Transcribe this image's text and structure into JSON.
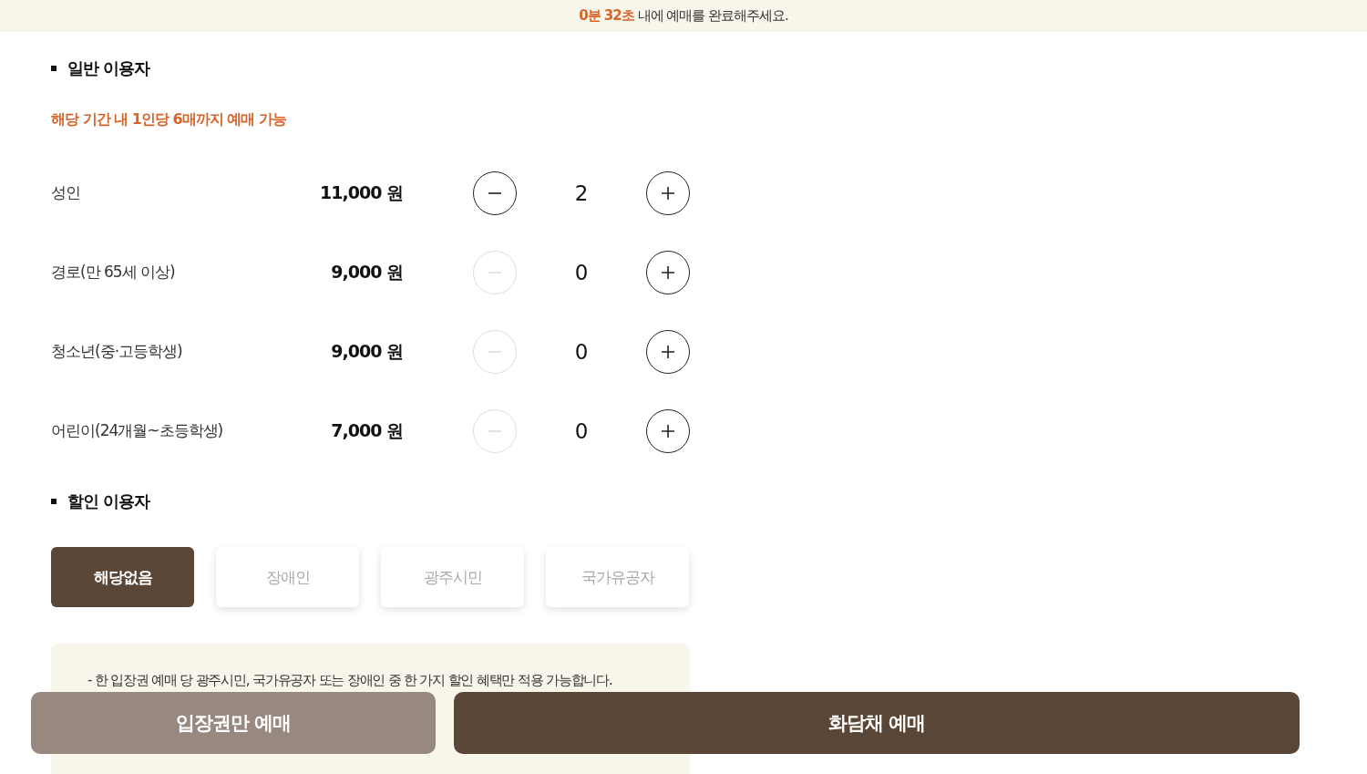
{
  "timer_bar": {
    "time": "0분 32초",
    "message": "내에 예매를 완료해주세요."
  },
  "general": {
    "title": "일반 이용자",
    "limit_note": "해당 기간 내 1인당 6매까지 예매 가능",
    "rows": [
      {
        "name": "성인",
        "price": "11,000 원",
        "count": "2",
        "minus_disabled": false
      },
      {
        "name": "경로(만 65세 이상)",
        "price": "9,000 원",
        "count": "0",
        "minus_disabled": true
      },
      {
        "name": "청소년(중·고등학생)",
        "price": "9,000 원",
        "count": "0",
        "minus_disabled": true
      },
      {
        "name": "어린이(24개월~초등학생)",
        "price": "7,000 원",
        "count": "0",
        "minus_disabled": true
      }
    ]
  },
  "discount": {
    "title": "할인 이용자",
    "options": [
      {
        "label": "해당없음",
        "selected": true
      },
      {
        "label": "장애인",
        "selected": false
      },
      {
        "label": "광주시민",
        "selected": false
      },
      {
        "label": "국가유공자",
        "selected": false
      }
    ]
  },
  "notice": {
    "line": "-  한 입장권 예매 당 광주시민, 국가유공자 또는 장애인 중 한 가지 할인 혜택만 적용 가능합니다."
  },
  "actions": [
    {
      "label": "입장권만 예매",
      "kind": "secondary"
    },
    {
      "label": "화담채 예매",
      "kind": "primary"
    }
  ]
}
